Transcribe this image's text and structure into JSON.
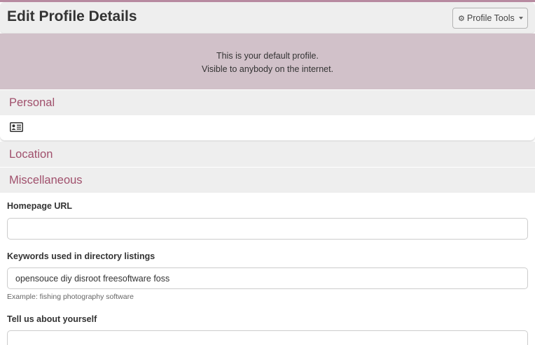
{
  "header": {
    "title": "Edit Profile Details",
    "tools_button": {
      "label": "Profile Tools",
      "icon": "gear-icon"
    }
  },
  "notice": {
    "line1": "This is your default profile.",
    "line2": "Visible to anybody on the internet."
  },
  "sections": {
    "personal": {
      "title": "Personal",
      "icon": "contact-card-icon"
    },
    "location": {
      "title": "Location"
    },
    "misc": {
      "title": "Miscellaneous"
    }
  },
  "form": {
    "homepage": {
      "label": "Homepage URL",
      "value": ""
    },
    "keywords": {
      "label": "Keywords used in directory listings",
      "value": "opensouce diy disroot freesoftware foss",
      "hint": "Example: fishing photography software"
    },
    "about": {
      "label": "Tell us about yourself",
      "value": ""
    }
  },
  "colors": {
    "accent": "#a0506c",
    "notice_bg": "#d1c1c9",
    "section_bg": "#eeeeee"
  }
}
